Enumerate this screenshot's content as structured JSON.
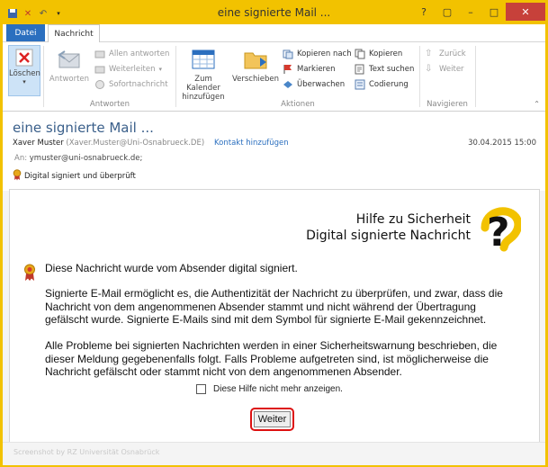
{
  "window": {
    "title": "eine signierte Mail ...",
    "buttons": {
      "help": "?",
      "restore": "▢",
      "minimize": "–",
      "maximize": "□",
      "close": "✕"
    }
  },
  "tabs": {
    "file": "Datei",
    "message": "Nachricht"
  },
  "ribbon": {
    "delete": {
      "label": "Löschen"
    },
    "reply": {
      "label": "Antworten",
      "reply_all": "Allen antworten",
      "forward": "Weiterleiten",
      "instant": "Sofortnachricht",
      "group": "Antworten"
    },
    "actions": {
      "calendar": "Zum Kalender hinzufügen",
      "move": "Verschieben",
      "copy_to": "Kopieren nach",
      "mark": "Markieren",
      "monitor": "Überwachen",
      "copy": "Kopieren",
      "find_text": "Text suchen",
      "encoding": "Codierung",
      "group": "Aktionen"
    },
    "navigate": {
      "back": "Zurück",
      "forward": "Weiter",
      "group": "Navigieren"
    }
  },
  "message": {
    "subject": "eine signierte Mail ...",
    "sender_name": "Xaver Muster",
    "sender_address": "(Xaver.Muster@Uni-Osnabrueck.DE)",
    "add_contact": "Kontakt hinzufügen",
    "date": "30.04.2015 15:00",
    "to_label": "An:",
    "to": "ymuster@uni-osnabrueck.de;",
    "signature_status": "Digital signiert und überprüft"
  },
  "help": {
    "title_line1": "Hilfe zu Sicherheit",
    "title_line2": "Digital signierte Nachricht",
    "para1": "Diese Nachricht wurde vom Absender digital signiert.",
    "para2": "Signierte E-Mail ermöglicht es, die Authentizität der Nachricht zu überprüfen, und zwar, dass die Nachricht von dem angenommenen Absender stammt und nicht während der Übertragung gefälscht wurde. Signierte E-Mails sind mit dem Symbol für signierte E-Mail gekennzeichnet.",
    "para3": "Alle Probleme bei signierten Nachrichten werden in einer Sicherheitswarnung beschrieben, die dieser Meldung gegebenenfalls folgt. Falls Probleme aufgetreten sind, ist möglicherweise die Nachricht gefälscht oder stammt nicht von dem angenommenen Absender.",
    "checkbox_label": "Diese Hilfe nicht mehr anzeigen.",
    "checkbox_checked": false,
    "button": "Weiter"
  },
  "status": {
    "watermark": "Screenshot by RZ Universität Osnabrück"
  },
  "colors": {
    "titlebar": "#f2c200",
    "accent": "#2b6fbf",
    "close": "#c7413a",
    "highlight": "#d11111"
  }
}
